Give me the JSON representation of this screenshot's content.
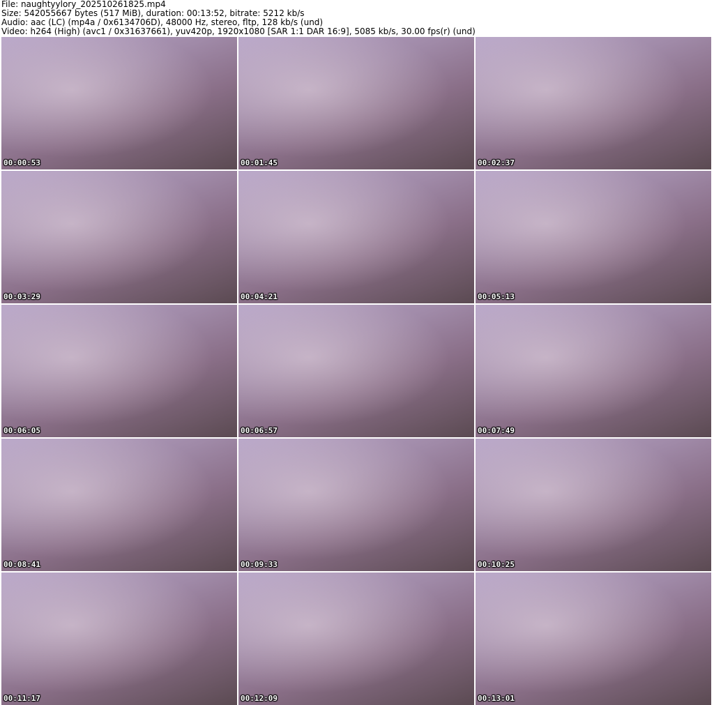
{
  "header": {
    "file": "File: naughtyylory_202510261825.mp4",
    "size": "Size: 542055667 bytes (517 MiB), duration: 00:13:52, bitrate: 5212 kb/s",
    "audio": "Audio: aac (LC) (mp4a / 0x6134706D), 48000 Hz, stereo, fltp, 128 kb/s (und)",
    "video": "Video: h264 (High) (avc1 / 0x31637661), yuv420p, 1920x1080 [SAR 1:1 DAR 16:9], 5085 kb/s, 30.00 fps(r) (und)"
  },
  "thumbnails": [
    "00:00:53",
    "00:01:45",
    "00:02:37",
    "00:03:29",
    "00:04:21",
    "00:05:13",
    "00:06:05",
    "00:06:57",
    "00:07:49",
    "00:08:41",
    "00:09:33",
    "00:10:25",
    "00:11:17",
    "00:12:09",
    "00:13:01"
  ]
}
